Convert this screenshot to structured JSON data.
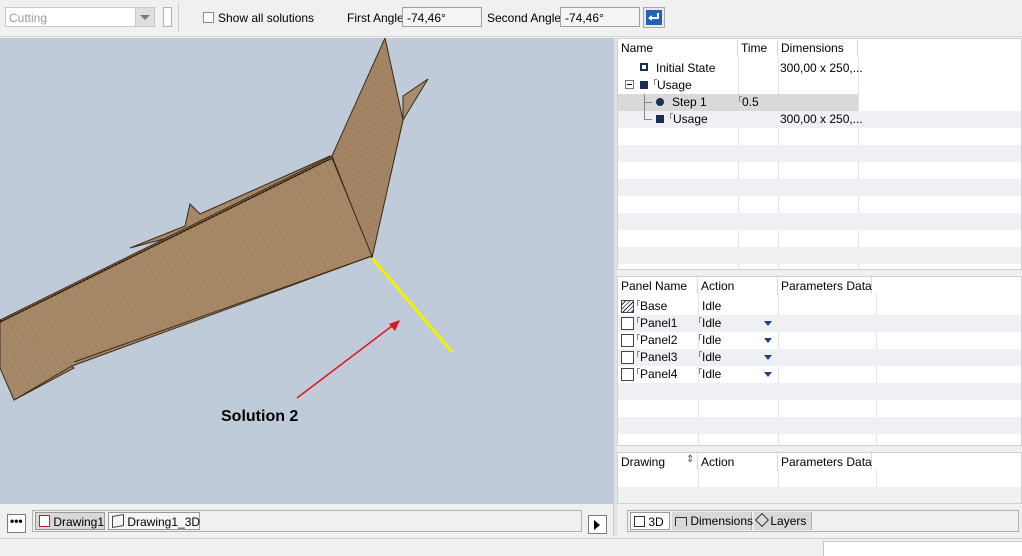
{
  "toolbar": {
    "mode_value": "Cutting",
    "show_all_label": "Show all solutions",
    "first_angle_label": "First Angle",
    "first_angle_value": "-74,46°",
    "second_angle_label": "Second Angle",
    "second_angle_value": "-74,46°"
  },
  "viewport": {
    "annotation": "Solution 2",
    "doc_tabs": [
      "Drawing1",
      "Drawing1_3D"
    ]
  },
  "steps_panel": {
    "headers": [
      "Name",
      "Time",
      "Dimensions"
    ],
    "rows": [
      {
        "name": "Initial State",
        "time": "",
        "dimensions": "300,00 x 250,..."
      },
      {
        "name": "Usage",
        "time": "",
        "dimensions": ""
      },
      {
        "name": "Step 1",
        "time": "0.5",
        "dimensions": ""
      },
      {
        "name": "Usage",
        "time": "",
        "dimensions": "300,00 x 250,..."
      }
    ]
  },
  "panels_panel": {
    "headers": [
      "Panel Name",
      "Action",
      "Parameters Data"
    ],
    "rows": [
      {
        "name": "Base",
        "action": "Idle"
      },
      {
        "name": "Panel1",
        "action": "Idle"
      },
      {
        "name": "Panel2",
        "action": "Idle"
      },
      {
        "name": "Panel3",
        "action": "Idle"
      },
      {
        "name": "Panel4",
        "action": "Idle"
      }
    ]
  },
  "drawing_panel": {
    "headers": [
      "Drawing",
      "Action",
      "Parameters Data"
    ]
  },
  "bottom_tabs": [
    "3D",
    "Dimensions",
    "Layers"
  ],
  "colors": {
    "viewport_bg": "#bfcbd8",
    "cardboard": "#a68866",
    "highlight_line": "#f2f000",
    "arrow": "#e0141b",
    "accent_blue": "#1e63b5"
  }
}
